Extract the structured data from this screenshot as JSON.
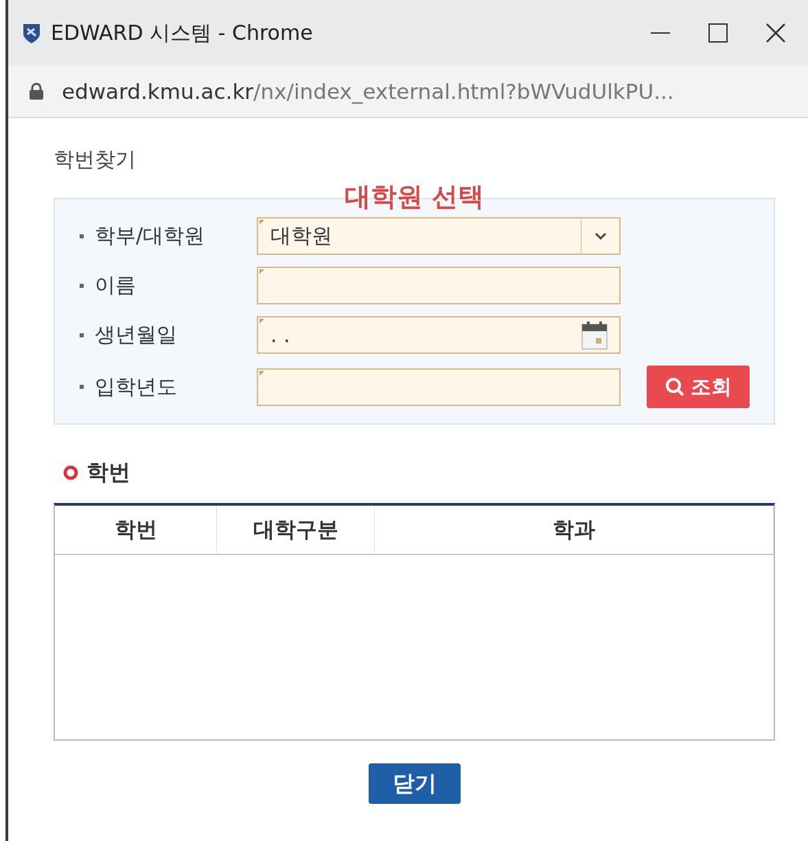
{
  "window": {
    "title": "EDWARD 시스템 - Chrome"
  },
  "address_bar": {
    "domain": "edward.kmu.ac.kr",
    "path": "/nx/index_external.html?bWVudUlkPU..."
  },
  "page_title": "학번찾기",
  "annotation": "대학원 선택",
  "form": {
    "fields": [
      {
        "kind": "select",
        "label": "학부/대학원",
        "value": "대학원"
      },
      {
        "kind": "text",
        "label": "이름"
      },
      {
        "kind": "date",
        "label": "생년월일",
        "value": ". ."
      },
      {
        "kind": "text",
        "label": "입학년도"
      }
    ],
    "search_button": "조회"
  },
  "results": {
    "title": "학번",
    "columns": [
      "학번",
      "대학구분",
      "학과"
    ]
  },
  "close_button": "닫기"
}
